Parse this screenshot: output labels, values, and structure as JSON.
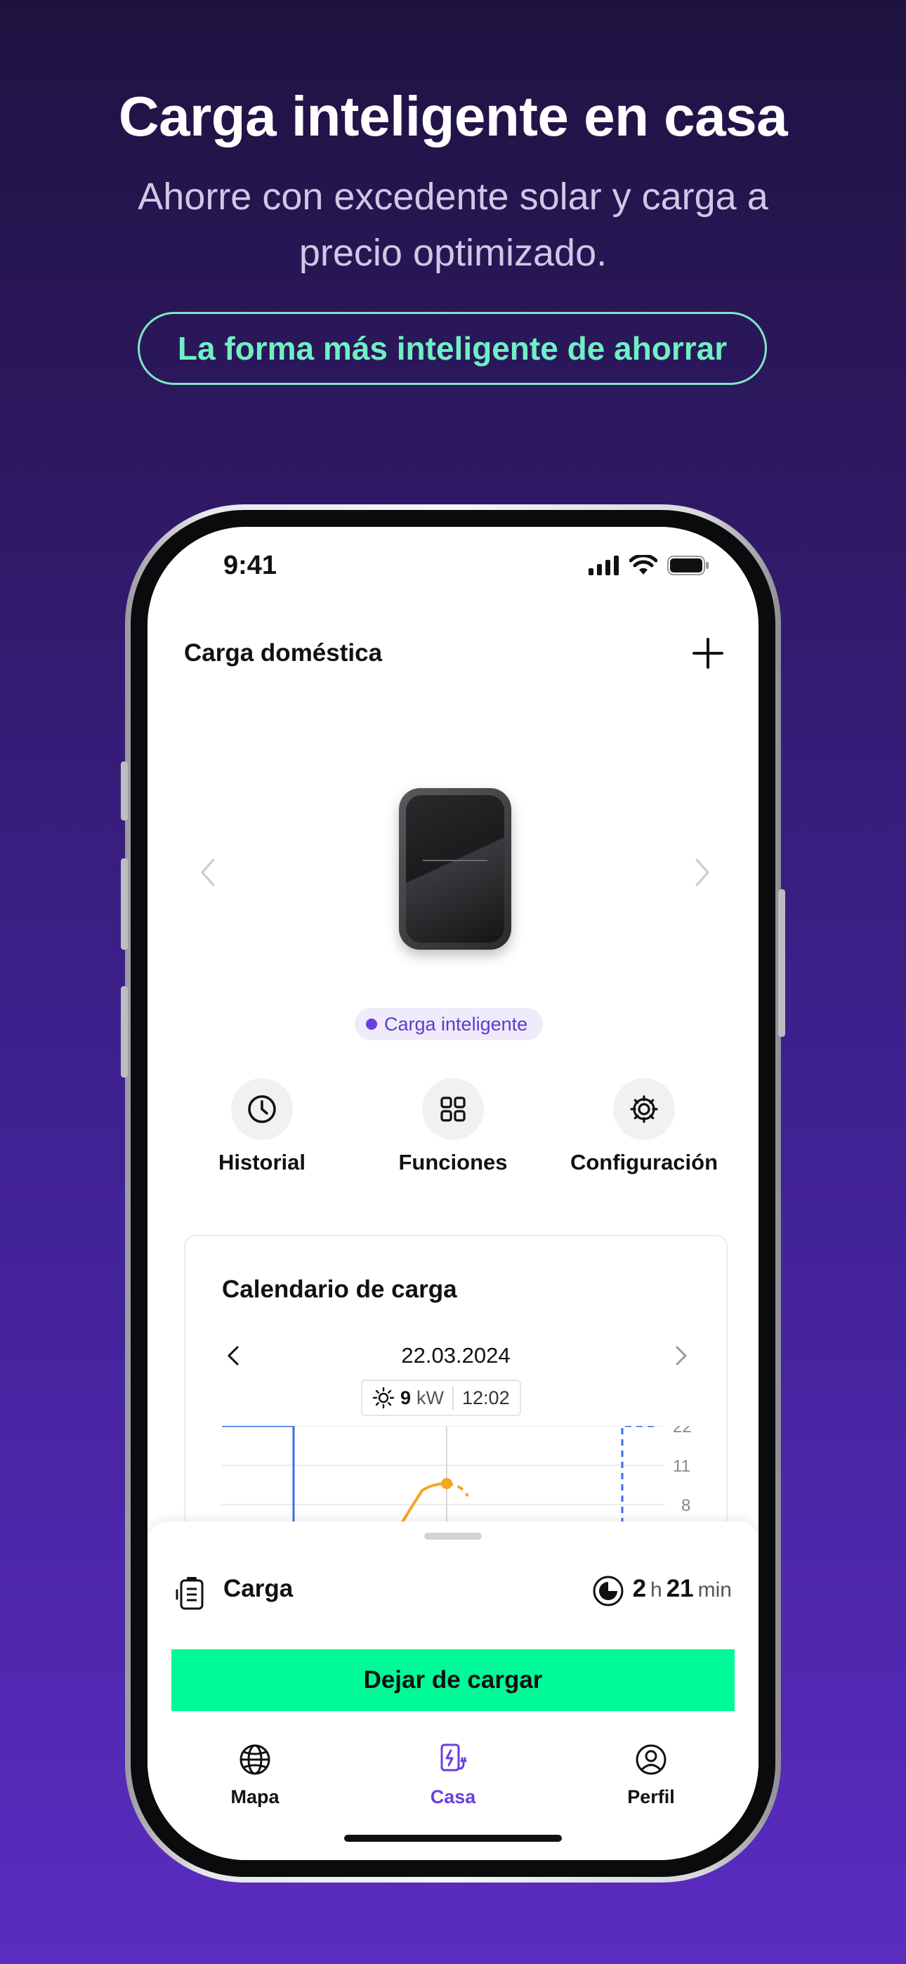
{
  "hero": {
    "title": "Carga inteligente en casa",
    "subtitle": "Ahorre con excedente solar y carga a precio optimizado.",
    "pill": "La forma más inteligente de ahorrar"
  },
  "status_bar": {
    "time": "9:41"
  },
  "header": {
    "title": "Carga doméstica",
    "add_icon": "plus-icon"
  },
  "device": {
    "mode_label": "Carga inteligente"
  },
  "quick_actions": [
    {
      "label": "Historial",
      "icon": "clock-icon"
    },
    {
      "label": "Funciones",
      "icon": "grid-icon"
    },
    {
      "label": "Configuración",
      "icon": "gear-icon"
    }
  ],
  "calendar": {
    "title": "Calendario de carga",
    "date": "22.03.2024",
    "tooltip": {
      "power": "9",
      "unit": "kW",
      "time": "12:02"
    },
    "y_ticks": [
      "22",
      "11",
      "8"
    ]
  },
  "charge": {
    "label": "Carga",
    "hours": "2",
    "hours_unit": "h",
    "minutes": "21",
    "minutes_unit": "min",
    "stop_button": "Dejar de cargar"
  },
  "tabs": [
    {
      "label": "Mapa",
      "icon": "globe-icon",
      "active": false
    },
    {
      "label": "Casa",
      "icon": "home-charger-icon",
      "active": true
    },
    {
      "label": "Perfil",
      "icon": "profile-icon",
      "active": false
    }
  ],
  "colors": {
    "accent": "#6a3fe0",
    "cta": "#00fa98",
    "pill_text": "#6ff0c3",
    "chart_blue": "#3b6fe8",
    "chart_orange": "#f5a623"
  }
}
